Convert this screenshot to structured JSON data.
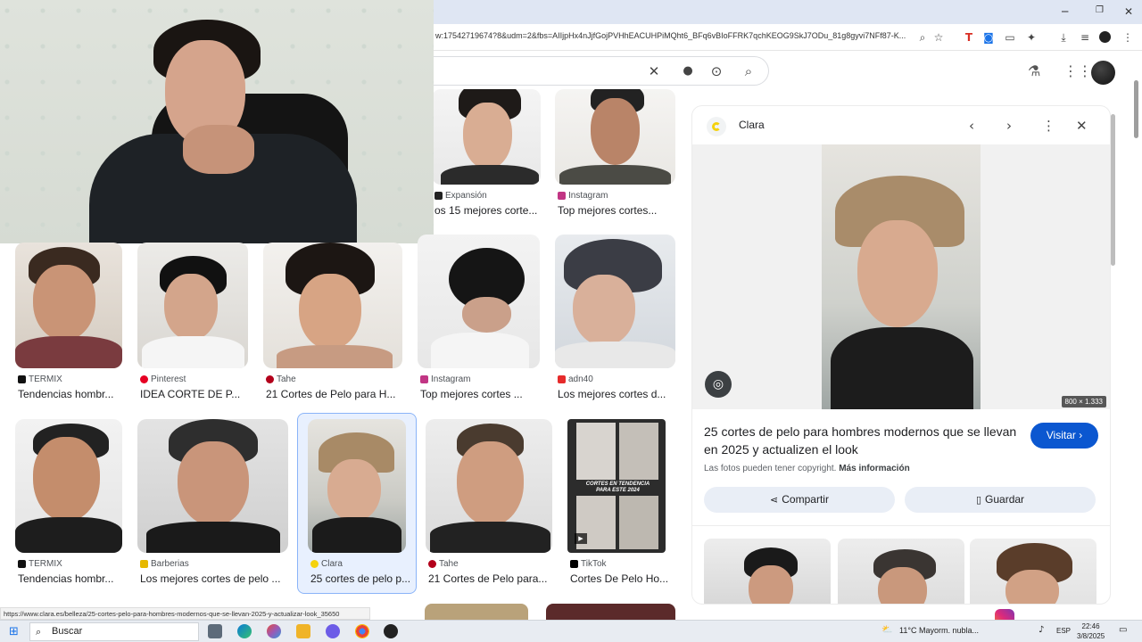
{
  "browser": {
    "url": "w:17542719674?8&udm=2&fbs=AIIjpHx4nJjfGojPVHhEACUHPiMQht6_BFq6vBIoFFRK7qchKEOG9SkJ7ODu_81g8gyvi7NFf87-K...",
    "win_min": "─",
    "win_restore": "❐",
    "win_close": "✕"
  },
  "search": {
    "clear_icon": "✕",
    "mic_icon": "🎤",
    "lens_icon": "⊙",
    "search_icon": "⌕"
  },
  "results": {
    "row0": [
      {
        "source": "Expansión",
        "title": "os 15 mejores corte...",
        "fav": "#222222"
      },
      {
        "source": "Instagram",
        "title": "Top mejores cortes...",
        "fav": "#c13584"
      }
    ],
    "row1": [
      {
        "source": "TERMIX",
        "title": "Tendencias hombr...",
        "fav": "#111111"
      },
      {
        "source": "Pinterest",
        "title": "IDEA CORTE DE P...",
        "fav": "#e60023"
      },
      {
        "source": "Tahe",
        "title": "21 Cortes de Pelo para H...",
        "fav": "#b3001b"
      },
      {
        "source": "Instagram",
        "title": "Top mejores cortes ...",
        "fav": "#c13584"
      },
      {
        "source": "adn40",
        "title": "Los mejores cortes d...",
        "fav": "#e62b2b"
      }
    ],
    "row2": [
      {
        "source": "TERMIX",
        "title": "Tendencias hombr...",
        "fav": "#111111"
      },
      {
        "source": "Barberias",
        "title": "Los mejores cortes de pelo ...",
        "fav": "#e6b800"
      },
      {
        "source": "Clara",
        "title": "25 cortes de pelo p...",
        "fav": "#f5d20d"
      },
      {
        "source": "Tahe",
        "title": "21 Cortes de Pelo para...",
        "fav": "#b3001b"
      },
      {
        "source": "TikTok",
        "title": "Cortes De Pelo Ho...",
        "fav": "#000000"
      }
    ],
    "tiktok_overlay": "CORTES EN TENDENCIA PARA ESTE 2024"
  },
  "panel": {
    "source": "Clara",
    "dims": "800 × 1.333",
    "title": "25 cortes de pelo para hombres modernos que se llevan en 2025 y actualizen el look",
    "visit_label": "Visitar",
    "copyright_text": "Las fotos pueden tener copyright.",
    "more_info": "Más información",
    "share_label": "Compartir",
    "save_label": "Guardar"
  },
  "status_url": "https://www.clara.es/belleza/25-cortes-pelo-para-hombres-modernos-que-se-llevan-2025-y-actualizar-look_35650",
  "taskbar": {
    "search_label": "Buscar",
    "weather": "11°C  Mayorm. nubla...",
    "lang": "ESP",
    "time": "22:46",
    "date": "3/8/2025"
  }
}
